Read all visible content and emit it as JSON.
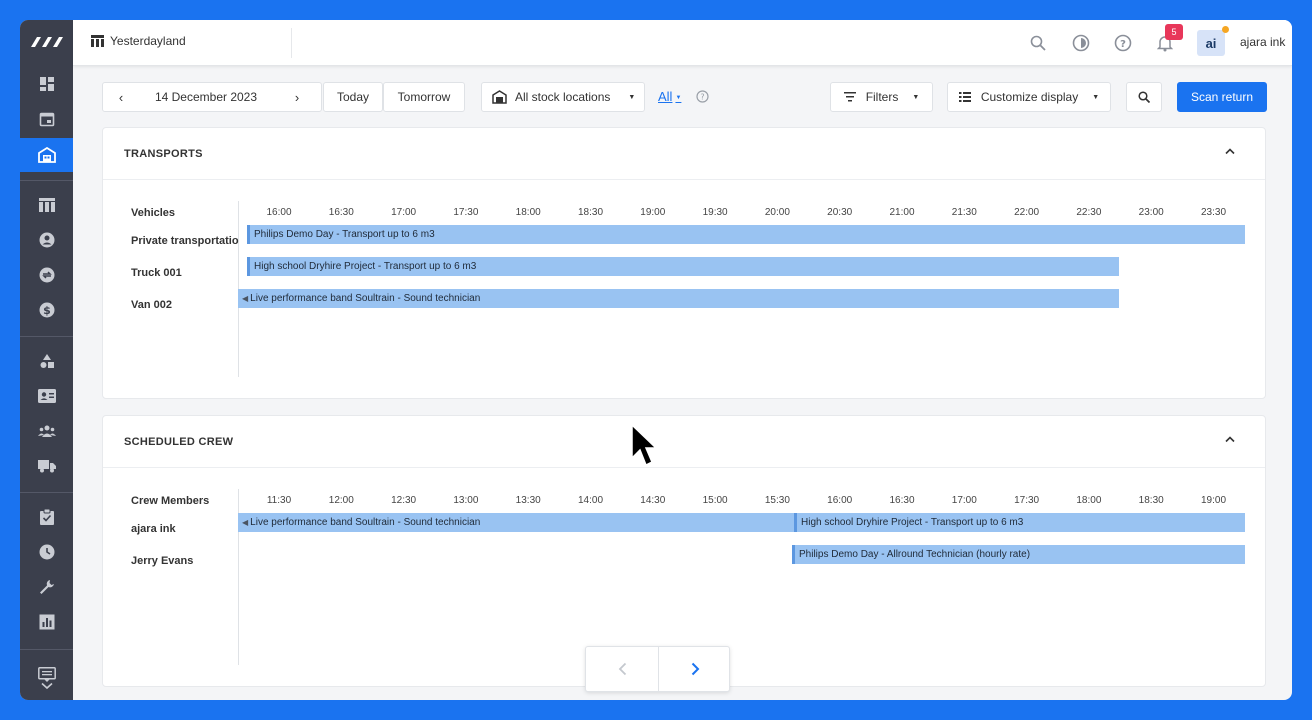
{
  "topbar": {
    "workspace": "Yesterdayland",
    "notifications_count": "5",
    "avatar_initials": "ai",
    "username": "ajara ink"
  },
  "sidebar": {
    "items": [
      {
        "icon": "dashboard-icon"
      },
      {
        "icon": "calendar-icon"
      },
      {
        "icon": "warehouse-icon",
        "active": true
      },
      {
        "icon": "table-icon"
      },
      {
        "icon": "contact-icon"
      },
      {
        "icon": "exchange-icon"
      },
      {
        "icon": "dollar-icon"
      },
      {
        "icon": "shapes-icon"
      },
      {
        "icon": "id-card-icon"
      },
      {
        "icon": "people-icon"
      },
      {
        "icon": "truck-icon"
      },
      {
        "icon": "clipboard-check-icon"
      },
      {
        "icon": "clock-icon"
      },
      {
        "icon": "wrench-icon"
      },
      {
        "icon": "chart-icon"
      },
      {
        "icon": "feedback-icon"
      }
    ]
  },
  "toolbar": {
    "date": "14 December 2023",
    "today": "Today",
    "tomorrow": "Tomorrow",
    "stock_location": "All stock locations",
    "all_link": "All",
    "filters": "Filters",
    "customize": "Customize display",
    "scan_return": "Scan return"
  },
  "transports": {
    "title": "TRANSPORTS",
    "column_header": "Vehicles",
    "ticks": [
      "16:00",
      "16:30",
      "17:00",
      "17:30",
      "18:00",
      "18:30",
      "19:00",
      "19:30",
      "20:00",
      "20:30",
      "21:00",
      "21:30",
      "22:00",
      "22:30",
      "23:00",
      "23:30"
    ],
    "rows": [
      {
        "label": "Private transportation",
        "bar": "Philips Demo Day - Transport up to 6 m3"
      },
      {
        "label": "Truck 001",
        "bar": "High school Dryhire Project - Transport up to 6 m3"
      },
      {
        "label": "Van 002",
        "bar": "Live performance band Soultrain - Sound technician"
      }
    ]
  },
  "crew": {
    "title": "SCHEDULED CREW",
    "column_header": "Crew Members",
    "ticks": [
      "11:30",
      "12:00",
      "12:30",
      "13:00",
      "13:30",
      "14:00",
      "14:30",
      "15:00",
      "15:30",
      "16:00",
      "16:30",
      "17:00",
      "17:30",
      "18:00",
      "18:30",
      "19:00"
    ],
    "rows": [
      {
        "label": "ajara ink",
        "bars": [
          "Live performance band Soultrain - Sound technician",
          "High school Dryhire Project - Transport up to 6 m3"
        ]
      },
      {
        "label": "Jerry Evans",
        "bars": [
          "Philips Demo Day - Allround Technician (hourly rate)"
        ]
      }
    ]
  }
}
